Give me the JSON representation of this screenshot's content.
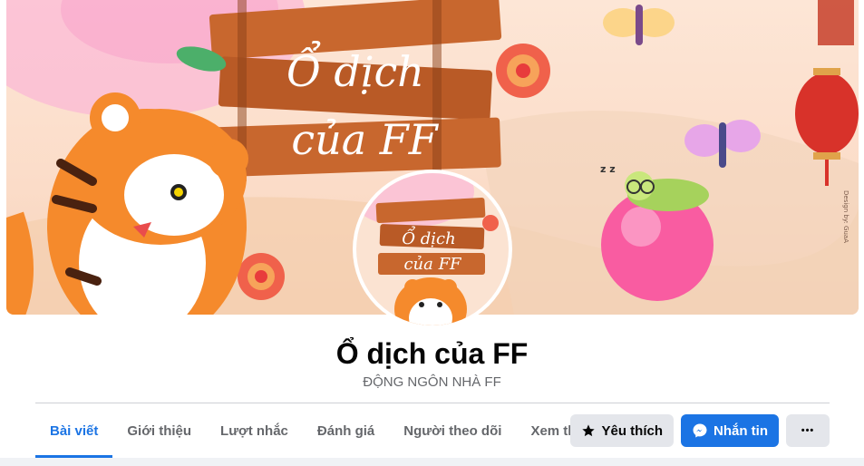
{
  "page": {
    "name": "Ổ dịch của FF",
    "category": "ĐỘNG NGÔN NHÀ FF"
  },
  "cover": {
    "sign_line1": "Ổ dịch",
    "sign_line2": "của FF",
    "credit": "Design by: GuaA"
  },
  "tabs": [
    {
      "label": "Bài viết",
      "active": true
    },
    {
      "label": "Giới thiệu"
    },
    {
      "label": "Lượt nhắc"
    },
    {
      "label": "Đánh giá"
    },
    {
      "label": "Người theo dõi"
    },
    {
      "label": "Xem thêm"
    }
  ],
  "actions": {
    "like_label": "Yêu thích",
    "message_label": "Nhắn tin",
    "more_label": "•••"
  },
  "colors": {
    "accent": "#1b74e4",
    "text_primary": "#050505",
    "text_secondary": "#65676b"
  }
}
